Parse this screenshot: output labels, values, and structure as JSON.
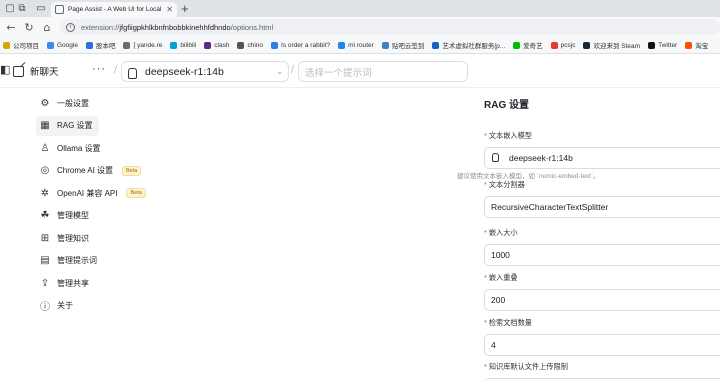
{
  "browser": {
    "tab": {
      "title": "Page Assist - A Web UI for Local AI"
    },
    "url": {
      "scheme": "extension://",
      "host": "jfgfiigpkhlkbnfnbobbkinehhfdhndo",
      "path": "/options.html"
    },
    "bookmarks": [
      {
        "label": "公司项目",
        "color": "#d9a400",
        "icon": "folder-icon"
      },
      {
        "label": "Google",
        "color": "#4285f4",
        "icon": "google-icon"
      },
      {
        "label": "股本吧",
        "color": "#2f6fd6",
        "icon": "paw-icon"
      },
      {
        "label": "[ yande.re",
        "color": "#6b6b6b",
        "icon": "page-icon"
      },
      {
        "label": "bilibili",
        "color": "#00a1d6",
        "icon": "bilibili-icon"
      },
      {
        "label": "clash",
        "color": "#5b2c83",
        "icon": "clash-icon"
      },
      {
        "label": "chino",
        "color": "#555555",
        "icon": "page-icon"
      },
      {
        "label": "Is order a rabbit?",
        "color": "#2b7de9",
        "icon": "page-icon"
      },
      {
        "label": "mi router",
        "color": "#1e88e5",
        "icon": "router-icon"
      },
      {
        "label": "贴吧云签到",
        "color": "#3b82c4",
        "icon": "cloud-icon"
      },
      {
        "label": "艺术虚拟社群服务[p...",
        "color": "#1565c0",
        "icon": "page-icon"
      },
      {
        "label": "爱奇艺",
        "color": "#00be06",
        "icon": "iqiyi-icon"
      },
      {
        "label": "pcsjc",
        "color": "#e53935",
        "icon": "page-icon"
      },
      {
        "label": "欢迎来到 Steam",
        "color": "#1b2838",
        "icon": "steam-icon"
      },
      {
        "label": "Twitter",
        "color": "#111111",
        "icon": "x-icon"
      },
      {
        "label": "淘宝",
        "color": "#ff5000",
        "icon": "taobao-icon"
      }
    ]
  },
  "header": {
    "new_chat": "新聊天",
    "more": "···",
    "model": "deepseek-r1:14b",
    "prompt_placeholder": "选择一个提示词"
  },
  "sidebar": {
    "items": [
      {
        "label": "一般设置",
        "icon": "gear-icon",
        "active": false
      },
      {
        "label": "RAG 设置",
        "icon": "rag-icon",
        "active": true
      },
      {
        "label": "Ollama 设置",
        "icon": "ollama-icon",
        "active": false
      },
      {
        "label": "Chrome AI 设置",
        "icon": "chrome-icon",
        "active": false,
        "badge": "Beta"
      },
      {
        "label": "OpenAI 兼容 API",
        "icon": "openai-icon",
        "active": false,
        "badge": "Beta"
      },
      {
        "label": "管理模型",
        "icon": "brain-icon",
        "active": false
      },
      {
        "label": "管理知识",
        "icon": "blocks-icon",
        "active": false
      },
      {
        "label": "管理提示词",
        "icon": "book-icon",
        "active": false
      },
      {
        "label": "管理共享",
        "icon": "share-icon",
        "active": false
      },
      {
        "label": "关于",
        "icon": "info-icon",
        "active": false
      }
    ]
  },
  "content": {
    "title": "RAG 设置",
    "fields": [
      {
        "label": "文本嵌入模型",
        "value": "deepseek-r1:14b",
        "help": "建议使用文本嵌入模型，如 `nomic-embed-text`。"
      },
      {
        "label": "文本分割器",
        "value": "RecursiveCharacterTextSplitter"
      },
      {
        "label": "嵌入大小",
        "value": "1000"
      },
      {
        "label": "嵌入重叠",
        "value": "200"
      },
      {
        "label": "检索文档数量",
        "value": "4"
      },
      {
        "label": "知识库默认文件上传限制",
        "value": ""
      }
    ]
  },
  "colors": {
    "required": "#e5484d",
    "active_bg": "#f1f3f5",
    "border": "#d9dde2"
  }
}
